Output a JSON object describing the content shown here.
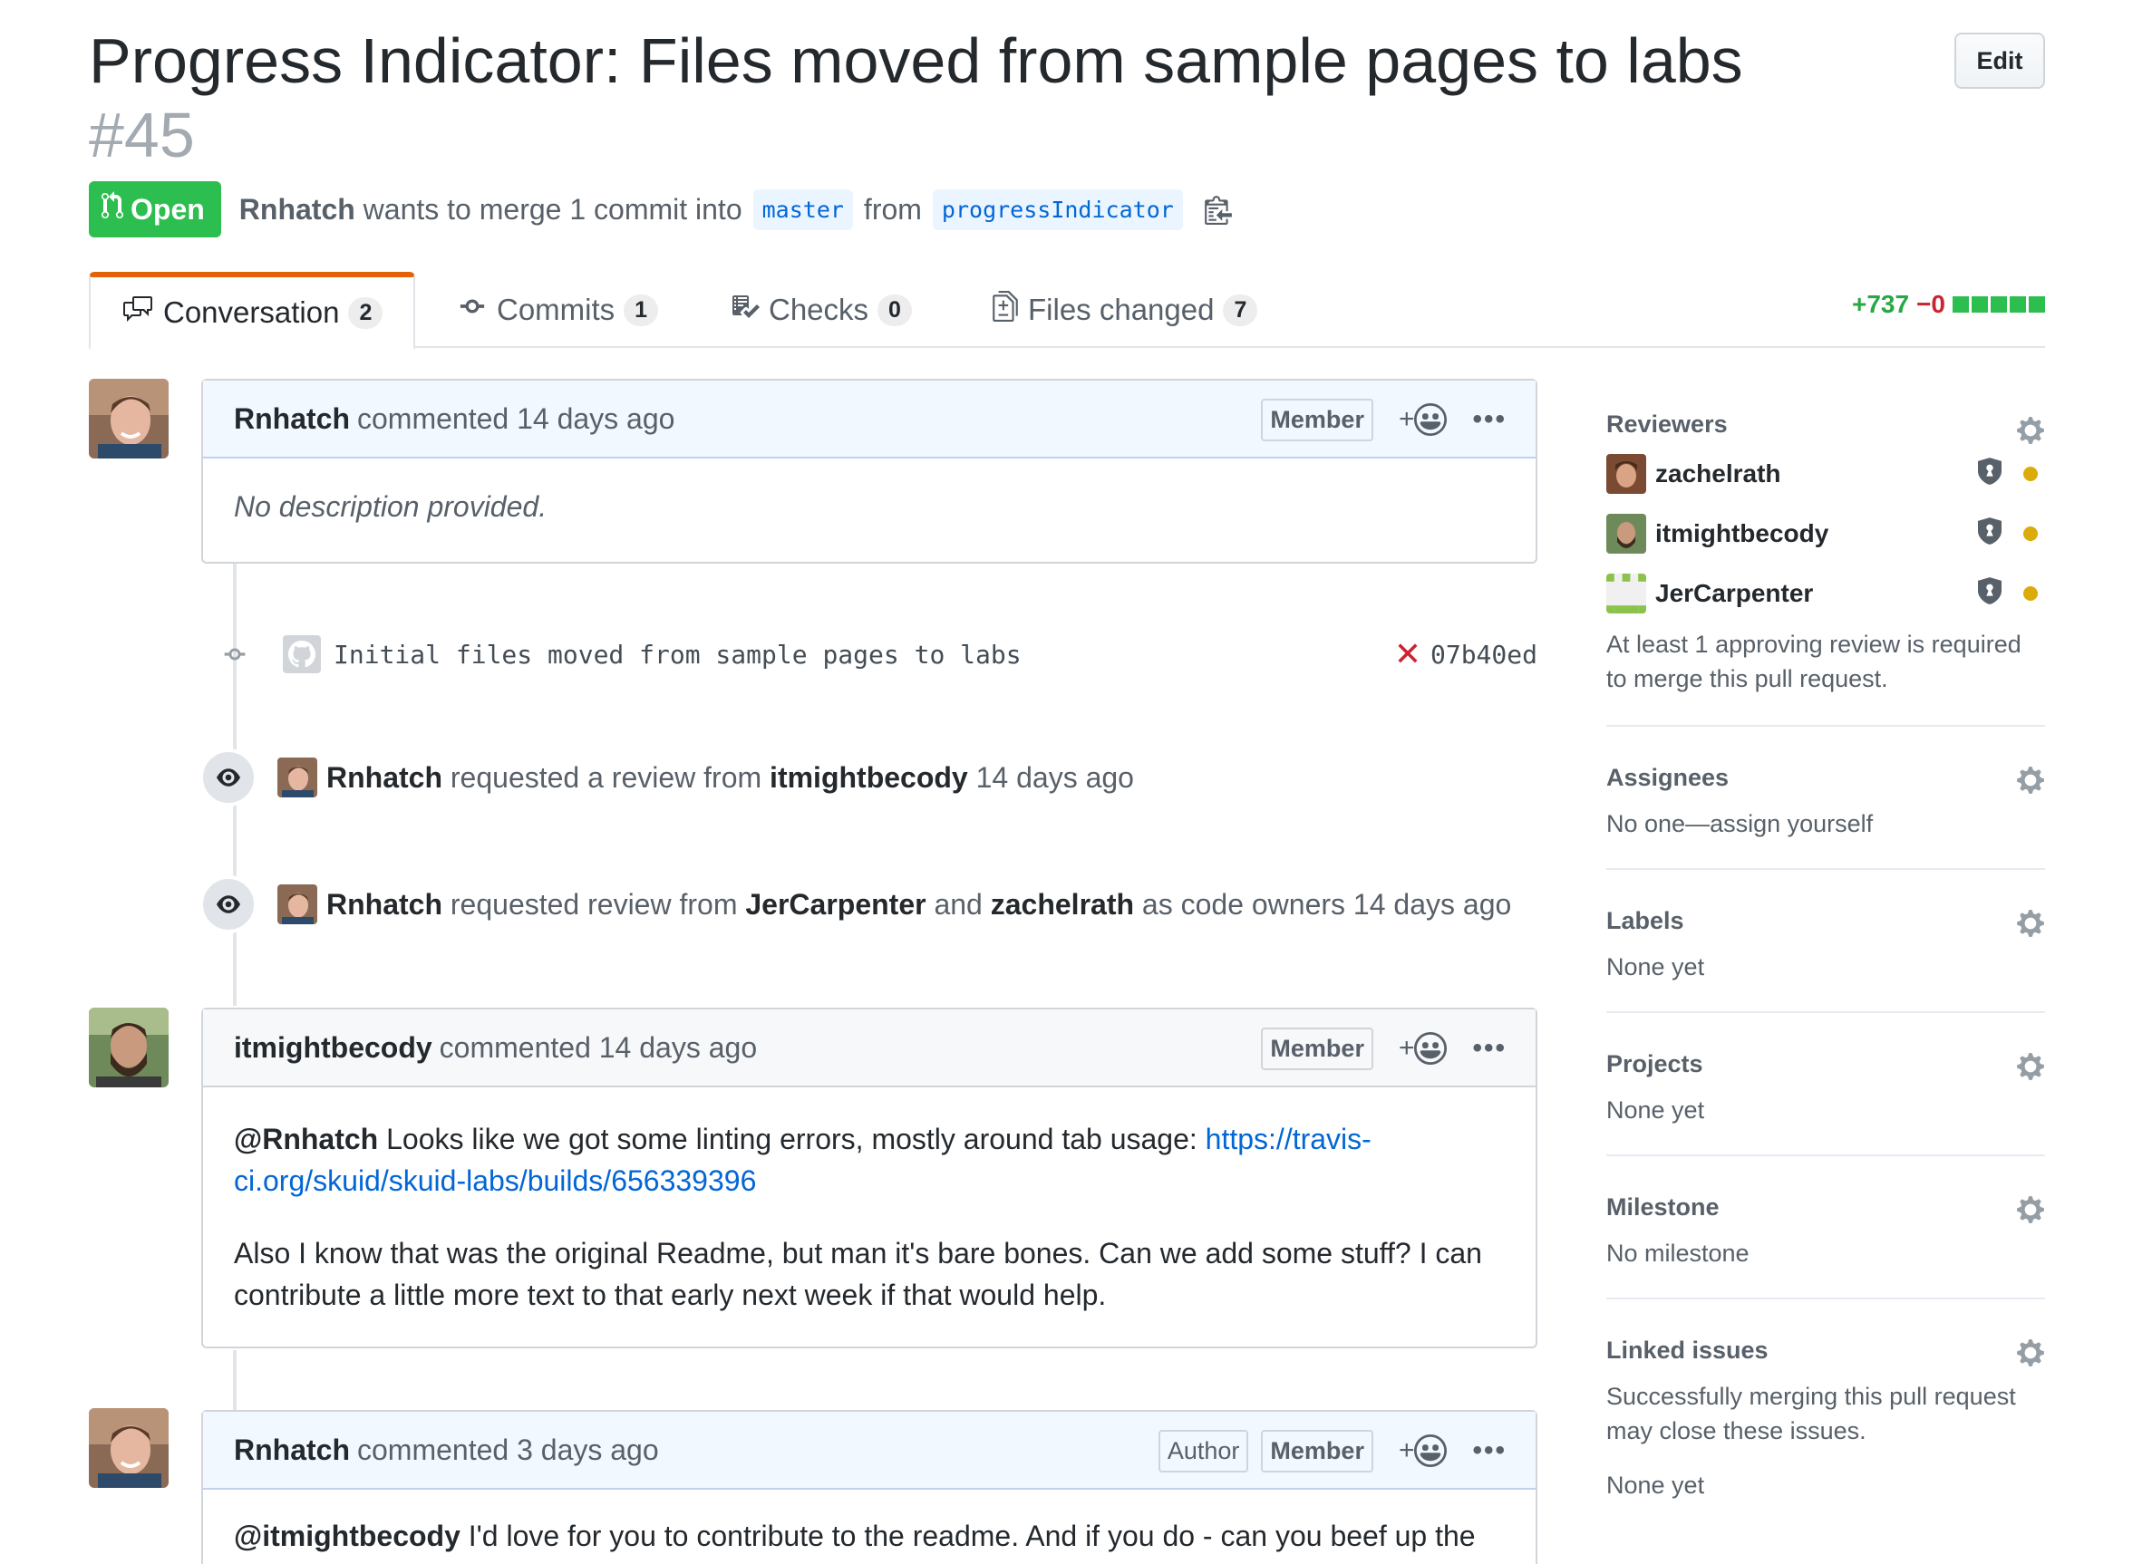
{
  "pr": {
    "title": "Progress Indicator: Files moved from sample pages to labs",
    "number": "#45",
    "edit_label": "Edit",
    "state": "Open",
    "author": "Rnhatch",
    "merge_text": "wants to merge 1 commit into",
    "base_branch": "master",
    "from_text": "from",
    "head_branch": "progressIndicator"
  },
  "tabs": [
    {
      "label": "Conversation",
      "count": "2"
    },
    {
      "label": "Commits",
      "count": "1"
    },
    {
      "label": "Checks",
      "count": "0"
    },
    {
      "label": "Files changed",
      "count": "7"
    }
  ],
  "diffstat": {
    "additions": "+737",
    "deletions": "−0"
  },
  "comments": [
    {
      "author": "Rnhatch",
      "meta": "commented 14 days ago",
      "badges": [
        "Member"
      ],
      "body": "No description provided."
    },
    {
      "author": "itmightbecody",
      "meta": "commented 14 days ago",
      "badges": [
        "Member"
      ],
      "mention": "@Rnhatch",
      "body1": " Looks like we got some linting errors, mostly around tab usage: ",
      "link": "https://travis-ci.org/skuid/skuid-labs/builds/656339396",
      "link_line1": "https://travis-",
      "link_line2": "ci.org/skuid/skuid-labs/builds/656339396",
      "body2": "Also I know that was the original Readme, but man it's bare bones. Can we add some stuff? I can contribute a little more text to that early next week if that would help."
    },
    {
      "author": "Rnhatch",
      "meta": "commented 3 days ago",
      "badges": [
        "Author",
        "Member"
      ],
      "mention": "@itmightbecody",
      "body": " I'd love for you to contribute to the readme. And if you do - can you beef up the"
    }
  ],
  "reactions": {
    "plus": "+"
  },
  "commit": {
    "message": "Initial files moved from sample pages to labs",
    "sha": "07b40ed",
    "status": "✕"
  },
  "events": [
    {
      "actor": "Rnhatch",
      "text": "requested a review from",
      "target": "itmightbecody",
      "time": "14 days ago"
    },
    {
      "actor": "Rnhatch",
      "text": "requested review from",
      "target1": "JerCarpenter",
      "and": "and",
      "target2": "zachelrath",
      "suffix": "as code owners 14 days ago"
    }
  ],
  "sidebar": {
    "reviewers_title": "Reviewers",
    "reviewers": [
      "zachelrath",
      "itmightbecody",
      "JerCarpenter"
    ],
    "reviewers_note": "At least 1 approving review is required to merge this pull request.",
    "assignees_title": "Assignees",
    "assignees_value": "No one—assign yourself",
    "labels_title": "Labels",
    "labels_value": "None yet",
    "projects_title": "Projects",
    "projects_value": "None yet",
    "milestone_title": "Milestone",
    "milestone_value": "No milestone",
    "linked_title": "Linked issues",
    "linked_note": "Successfully merging this pull request may close these issues.",
    "linked_value": "None yet"
  },
  "colors": {
    "open_green": "#2cbe4e",
    "link_blue": "#0366d6",
    "tab_accent": "#e36209",
    "deletion_red": "#cb2431",
    "pending_yellow": "#dbab09"
  }
}
